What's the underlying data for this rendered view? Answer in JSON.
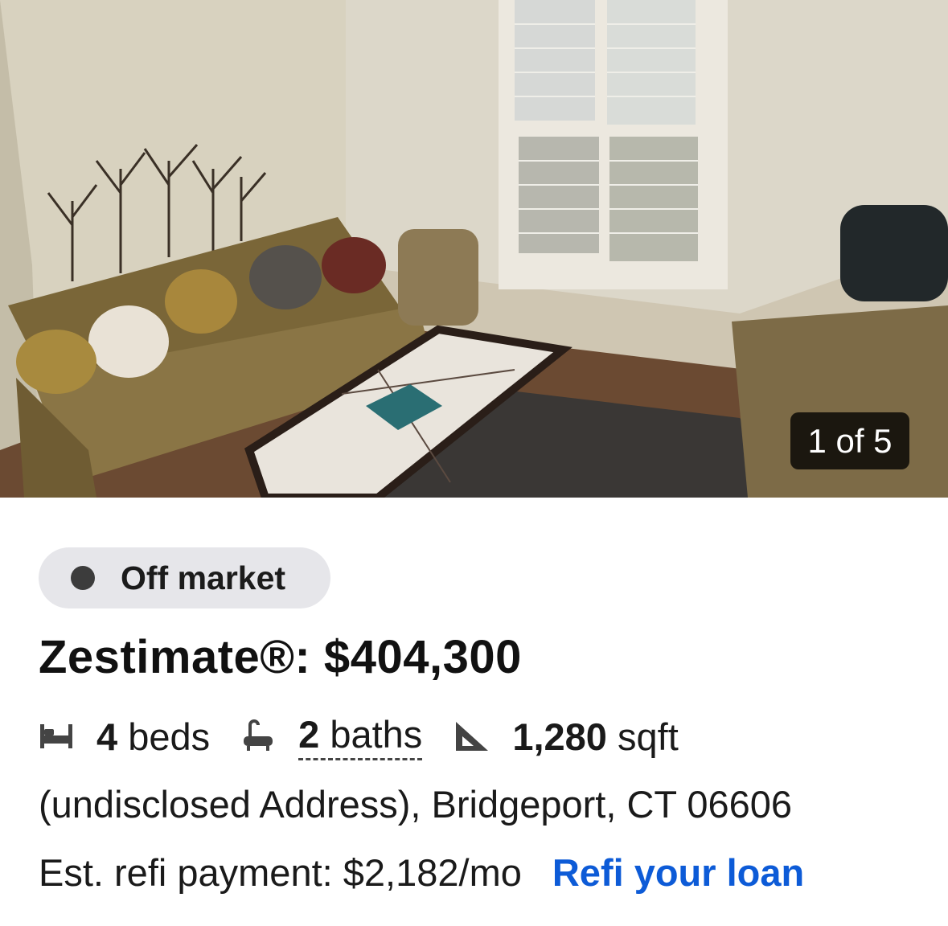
{
  "photo": {
    "counter": "1 of 5",
    "description_icon": "listing-photo"
  },
  "status": {
    "label": "Off market",
    "icon": "status-dot-icon"
  },
  "zestimate": {
    "text": "Zestimate®: $404,300"
  },
  "facts": {
    "beds_value": "4",
    "beds_label": "beds",
    "baths_value": "2",
    "baths_label": "baths",
    "sqft_value": "1,280",
    "sqft_label": "sqft",
    "icons": [
      "bed-icon",
      "bathtub-icon",
      "ruler-triangle-icon"
    ]
  },
  "address": {
    "text": "(undisclosed Address), Bridgeport, CT 06606"
  },
  "refi": {
    "text": "Est. refi payment: $2,182/mo",
    "link": "Refi your loan",
    "link_color": "#0d5bd7"
  }
}
